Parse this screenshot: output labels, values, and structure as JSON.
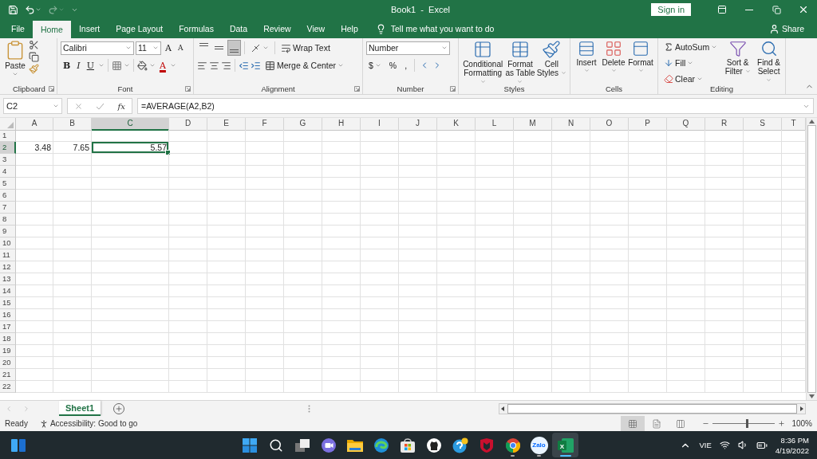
{
  "title_bar": {
    "title": "Book1  -  Excel",
    "sign_in": "Sign in",
    "redo_disabled": true
  },
  "ribbon_tabs": [
    {
      "label": "File",
      "selected": false
    },
    {
      "label": "Home",
      "selected": true
    },
    {
      "label": "Insert",
      "selected": false
    },
    {
      "label": "Page Layout",
      "selected": false
    },
    {
      "label": "Formulas",
      "selected": false
    },
    {
      "label": "Data",
      "selected": false
    },
    {
      "label": "Review",
      "selected": false
    },
    {
      "label": "View",
      "selected": false
    },
    {
      "label": "Help",
      "selected": false
    }
  ],
  "tell_me": "Tell me what you want to do",
  "share": "Share",
  "ribbon": {
    "clipboard": {
      "label": "Clipboard",
      "paste": "Paste"
    },
    "font": {
      "label": "Font",
      "font_name": "Calibri",
      "font_size": "11",
      "grow": "A",
      "shrink": "A",
      "bold": "B",
      "italic": "I",
      "underline": "U",
      "font_color": "A"
    },
    "alignment": {
      "label": "Alignment",
      "wrap_text": "Wrap Text",
      "merge_center": "Merge & Center",
      "vertical_align": [
        {
          "kind": "top",
          "selected": false
        },
        {
          "kind": "middle",
          "selected": false
        },
        {
          "kind": "bottom",
          "selected": true
        }
      ]
    },
    "number": {
      "label": "Number",
      "format": "Number",
      "currency": "$",
      "percent": "%",
      "comma": ","
    },
    "styles": {
      "label": "Styles",
      "buttons": [
        "Conditional Formatting",
        "Format as Table",
        "Cell Styles"
      ]
    },
    "cells": {
      "label": "Cells",
      "buttons": [
        "Insert",
        "Delete",
        "Format"
      ]
    },
    "editing": {
      "label": "Editing",
      "small_buttons": [
        "AutoSum",
        "Fill",
        "Clear"
      ],
      "buttons": [
        "Sort & Filter",
        "Find & Select"
      ]
    }
  },
  "formula_bar": {
    "name_box": "C2",
    "function": "fx",
    "formula": "=AVERAGE(A2,B2)"
  },
  "sheet": {
    "columns": [
      {
        "label": "A",
        "selected": false
      },
      {
        "label": "B",
        "selected": false
      },
      {
        "label": "C",
        "selected": true
      },
      {
        "label": "D",
        "selected": false
      },
      {
        "label": "E",
        "selected": false
      },
      {
        "label": "F",
        "selected": false
      },
      {
        "label": "G",
        "selected": false
      },
      {
        "label": "H",
        "selected": false
      },
      {
        "label": "I",
        "selected": false
      },
      {
        "label": "J",
        "selected": false
      },
      {
        "label": "K",
        "selected": false
      },
      {
        "label": "L",
        "selected": false
      },
      {
        "label": "M",
        "selected": false
      },
      {
        "label": "N",
        "selected": false
      },
      {
        "label": "O",
        "selected": false
      },
      {
        "label": "P",
        "selected": false
      },
      {
        "label": "Q",
        "selected": false
      },
      {
        "label": "R",
        "selected": false
      },
      {
        "label": "S",
        "selected": false
      },
      {
        "label": "T",
        "selected": false
      }
    ],
    "rows": [
      {
        "header": "1",
        "selected": false
      },
      {
        "header": "2",
        "selected": true,
        "cells": [
          {
            "value": "3.48",
            "selected": false
          },
          {
            "value": "7.65",
            "selected": false
          },
          {
            "value": "5.57",
            "selected": true
          }
        ]
      },
      {
        "header": "3",
        "selected": false
      },
      {
        "header": "4",
        "selected": false
      },
      {
        "header": "5",
        "selected": false
      },
      {
        "header": "6",
        "selected": false
      },
      {
        "header": "7",
        "selected": false
      },
      {
        "header": "8",
        "selected": false
      },
      {
        "header": "9",
        "selected": false
      },
      {
        "header": "10",
        "selected": false
      },
      {
        "header": "11",
        "selected": false
      },
      {
        "header": "12",
        "selected": false
      },
      {
        "header": "13",
        "selected": false
      },
      {
        "header": "14",
        "selected": false
      },
      {
        "header": "15",
        "selected": false
      },
      {
        "header": "16",
        "selected": false
      },
      {
        "header": "17",
        "selected": false
      },
      {
        "header": "18",
        "selected": false
      },
      {
        "header": "19",
        "selected": false
      },
      {
        "header": "20",
        "selected": false
      },
      {
        "header": "21",
        "selected": false
      },
      {
        "header": "22",
        "selected": false
      }
    ]
  },
  "sheet_tabs": [
    {
      "label": "Sheet1",
      "selected": true
    }
  ],
  "status_bar": {
    "mode": "Ready",
    "accessibility": "Accessibility: Good to go",
    "views": [
      {
        "kind": "normal",
        "selected": true
      },
      {
        "kind": "page_layout",
        "selected": false
      },
      {
        "kind": "page_break",
        "selected": false
      }
    ],
    "zoom": {
      "level": 0.55,
      "reading": "100%"
    }
  },
  "taskbar": {
    "apps": [
      {
        "kind": "start",
        "running": false,
        "active": false
      },
      {
        "kind": "search",
        "running": false,
        "active": false
      },
      {
        "kind": "task_view",
        "running": false,
        "active": false
      },
      {
        "kind": "chat",
        "running": false,
        "active": false
      },
      {
        "kind": "explorer",
        "running": false,
        "active": false
      },
      {
        "kind": "edge",
        "running": false,
        "active": false
      },
      {
        "kind": "store",
        "running": false,
        "active": false
      },
      {
        "kind": "octocat",
        "running": false,
        "active": false
      },
      {
        "kind": "help",
        "running": false,
        "active": false
      },
      {
        "kind": "shield",
        "running": false,
        "active": false
      },
      {
        "kind": "chrome",
        "running": true,
        "active": false
      },
      {
        "kind": "zalo",
        "label": "Zalo",
        "running": true,
        "active": false
      },
      {
        "kind": "excel",
        "label": "X",
        "running": true,
        "active": true
      }
    ],
    "language": "VIE",
    "time": "8:36 PM",
    "date": "4/19/2022"
  }
}
